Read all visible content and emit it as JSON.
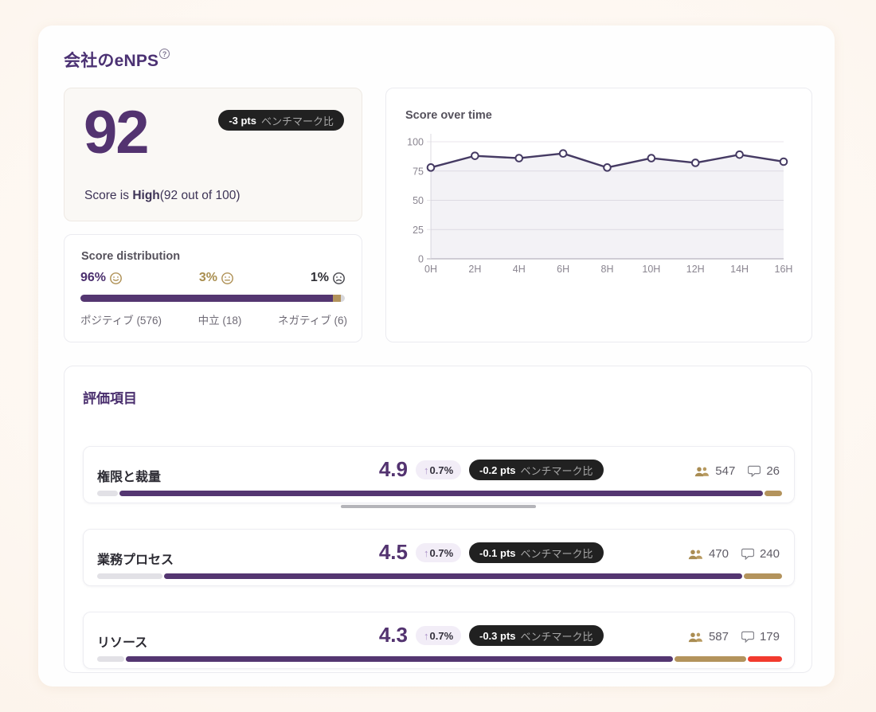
{
  "colors": {
    "accent_purple": "#533370",
    "gold": "#b5955a",
    "alert_red": "#f23a2e",
    "badge_black": "#212121",
    "track_gray": "#e2e1e6"
  },
  "header": {
    "title": "会社のeNPS",
    "info_icon": "?"
  },
  "score_card": {
    "score": "92",
    "benchmark": {
      "value": "-3 pts",
      "label": "ベンチマーク比"
    },
    "caption_prefix": "Score is ",
    "caption_bold": "High",
    "caption_suffix": "(92 out of 100)"
  },
  "distribution": {
    "title": "Score distribution",
    "segments": [
      {
        "percent": "96%",
        "face": "happy-face-icon",
        "label": "ポジティブ (576)",
        "value": 95.5
      },
      {
        "percent": "3%",
        "face": "neutral-face-icon",
        "label": "中立 (18)",
        "value": 3
      },
      {
        "percent": "1%",
        "face": "sad-face-icon",
        "label": "ネガティブ (6)",
        "value": 1.5
      }
    ]
  },
  "chart_data": {
    "type": "line",
    "title": "Score over time",
    "x": [
      "0H",
      "2H",
      "4H",
      "6H",
      "8H",
      "10H",
      "12H",
      "14H",
      "16H"
    ],
    "series": [
      {
        "name": "Score",
        "values": [
          78,
          88,
          86,
          90,
          78,
          86,
          82,
          89,
          83
        ]
      }
    ],
    "ylim": [
      0,
      100
    ],
    "yticks": [
      0,
      25,
      50,
      75,
      100
    ],
    "grid": true,
    "area_fill": true,
    "line_color": "#453a63",
    "marker": "open-circle",
    "legend": "none"
  },
  "evaluation": {
    "title": "評価項目",
    "rows": [
      {
        "label": "権限と裁量",
        "score": "4.9",
        "arrow": "↑",
        "change": "0.7%",
        "benchmark_value": "-0.2 pts",
        "benchmark_label": "ベンチマーク比",
        "respondents": "547",
        "comments": "26",
        "bar": {
          "gray_pct": 3,
          "purple_pct": 94,
          "gold_pct": 2.5,
          "red_pct": 0
        }
      },
      {
        "label": "業務プロセス",
        "score": "4.5",
        "arrow": "↑",
        "change": "0.7%",
        "benchmark_value": "-0.1 pts",
        "benchmark_label": "ベンチマーク比",
        "respondents": "470",
        "comments": "240",
        "bar": {
          "gray_pct": 9.5,
          "purple_pct": 84.5,
          "gold_pct": 5.5,
          "red_pct": 0
        }
      },
      {
        "label": "リソース",
        "score": "4.3",
        "arrow": "↑",
        "change": "0.7%",
        "benchmark_value": "-0.3 pts",
        "benchmark_label": "ベンチマーク比",
        "respondents": "587",
        "comments": "179",
        "bar": {
          "gray_pct": 4,
          "purple_pct": 80,
          "gold_pct": 10.5,
          "red_pct": 5
        }
      }
    ]
  }
}
